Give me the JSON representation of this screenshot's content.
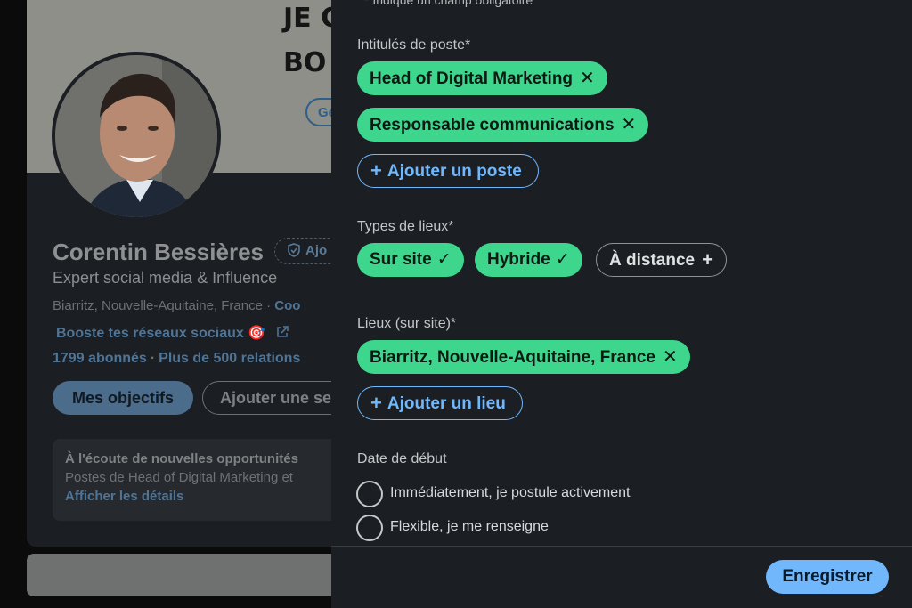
{
  "profile": {
    "banner_line1": "JE C",
    "banner_line2": "BO",
    "banner_pill": "Ge",
    "name": "Corentin Bessières",
    "verify_label": "Ajo",
    "headline": "Expert social media & Influence",
    "location": "Biarritz, Nouvelle-Aquitaine, France · ",
    "contact": "Coo",
    "link": "Booste tes réseaux sociaux 🎯",
    "followers": "1799 abonnés",
    "stats_separator": "·",
    "connections": "Plus de 500 relations",
    "goals_button": "Mes objectifs",
    "add_section_button": "Ajouter une se",
    "open_to_work": {
      "title": "À l'écoute de nouvelles opportunités",
      "subtitle": "Postes de Head of Digital Marketing et",
      "link": "Afficher les détails"
    }
  },
  "modal": {
    "hint": "Indique un champ obligatoire",
    "job_titles": {
      "label": "Intitulés de poste*",
      "chips": [
        "Head of Digital Marketing",
        "Responsable communications"
      ],
      "add_button": "Ajouter un poste"
    },
    "workplace_types": {
      "label": "Types de lieux*",
      "selected": [
        "Sur site",
        "Hybride"
      ],
      "unselected": [
        "À distance"
      ]
    },
    "locations": {
      "label": "Lieux (sur site)*",
      "chips": [
        "Biarritz, Nouvelle-Aquitaine, France"
      ],
      "add_button": "Ajouter un lieu"
    },
    "start_date": {
      "label": "Date de début",
      "options": [
        "Immédiatement, je postule activement",
        "Flexible, je me renseigne"
      ]
    },
    "save_button": "Enregistrer"
  },
  "colors": {
    "chip_green": "#3dd68c",
    "accent_blue": "#71b7fb",
    "modal_bg": "#1b1f23"
  }
}
